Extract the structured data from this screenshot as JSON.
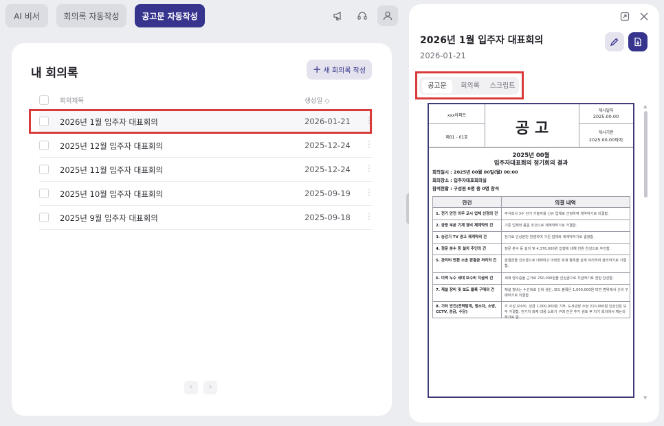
{
  "topnav": {
    "tabs": [
      {
        "label": "AI 비서"
      },
      {
        "label": "회의록 자동작성"
      },
      {
        "label": "공고문 자동작성"
      }
    ]
  },
  "icons": {
    "megaphone": "megaphone-icon",
    "headset": "headset-icon",
    "user": "user-icon"
  },
  "colors": {
    "accent": "#37348e",
    "highlight": "#d93b3b"
  },
  "left": {
    "title": "내 회의록",
    "new_button": "새 회의록 작성",
    "columns": {
      "title": "회의제목",
      "date": "생성일 ◇"
    },
    "rows": [
      {
        "title": "2026년 1월 입주자 대표회의",
        "date": "2026-01-21"
      },
      {
        "title": "2025년 12월 입주자 대표회의",
        "date": "2025-12-24"
      },
      {
        "title": "2025년 11월 입주자 대표회의",
        "date": "2025-12-24"
      },
      {
        "title": "2025년 10월 입주자 대표회의",
        "date": "2025-09-19"
      },
      {
        "title": "2025년 9월 입주자 대표회의",
        "date": "2025-09-18"
      }
    ],
    "pagination": {
      "prev": "‹",
      "next": "›"
    }
  },
  "right": {
    "title": "2026년 1월 입주자 대표회의",
    "date": "2026-01-21",
    "tabs": [
      "공고문",
      "회의록",
      "스크립트"
    ],
    "doc": {
      "apt": "xxx아파트",
      "gongo": "공 고",
      "no": "제01 - 01호",
      "posting_date_label": "게시일자",
      "posting_date": "2025.00.00",
      "period_label": "게시기한",
      "period": "2025.00.00까지",
      "heading1": "2025년 00월",
      "heading2": "입주자대표회의 정기회의 결과",
      "info": [
        "회의일시 : 2025년 00월 00일(월) 00:00",
        "회의장소 : 입주자대표회의실",
        "참석현황 : 구성원 0명 중 0명 참석"
      ],
      "table_headers": [
        "안건",
        "의결 내역"
      ],
      "agenda": [
        {
          "item": "1. 전기 안전 의무 교시 업체 선정의 건",
          "result": "주식회사 3수 전기 기술자를 신규 업체로 선정하여 계약하기로 의결함."
        },
        {
          "item": "2. 공용 부분 기계 경비 재계약의 건",
          "result": "기존 업체와 동일 조건으로 재계약하기로 가결함."
        },
        {
          "item": "3. 승강기 TV 광고 재계약의 건",
          "result": "전기료 인상분만 반영하여 기존 업체와 재계약하기로 결정함."
        },
        {
          "item": "4. 정문 분수 등 설치 추인의 건",
          "result": "정문 분수 등 설치 및 4,376,000원 집행에 대해 전원 찬성으로 추인함."
        },
        {
          "item": "5. 관리비 반환 소송 판결금 처리의 건",
          "result": "판결금을 선수금으로 대체하고 미비한 회계 항목을 상계 처리하여 정리하기로 가결함."
        },
        {
          "item": "6. 미액 누수 세대 보수비 지급의 건",
          "result": "세대 영수증을 근거로 250,000원을 선심금으로 지급하기로 전원 찬성함."
        },
        {
          "item": "7. 제설 장비 및 보도 블록 구매의 건",
          "result": "제설 장비는 수선비로 신비 생신, 보도 블록은 1,000,000원 미만 범위에서 신비 구매하기로 의결함."
        },
        {
          "item": "8. 기타 안건(전력탐계, 청소차, 소방, CCTV, 성금, 수당)",
          "result": "각 사성 보수비, 성금 1,000,000원 기부, 도서관장 수당 210,000원 인상안은 모두 가결함. 전기차 화재 대응 소화기 구매 건은 추가 검토 후 차기 회의에서 재논의하기로 함."
        }
      ]
    }
  }
}
